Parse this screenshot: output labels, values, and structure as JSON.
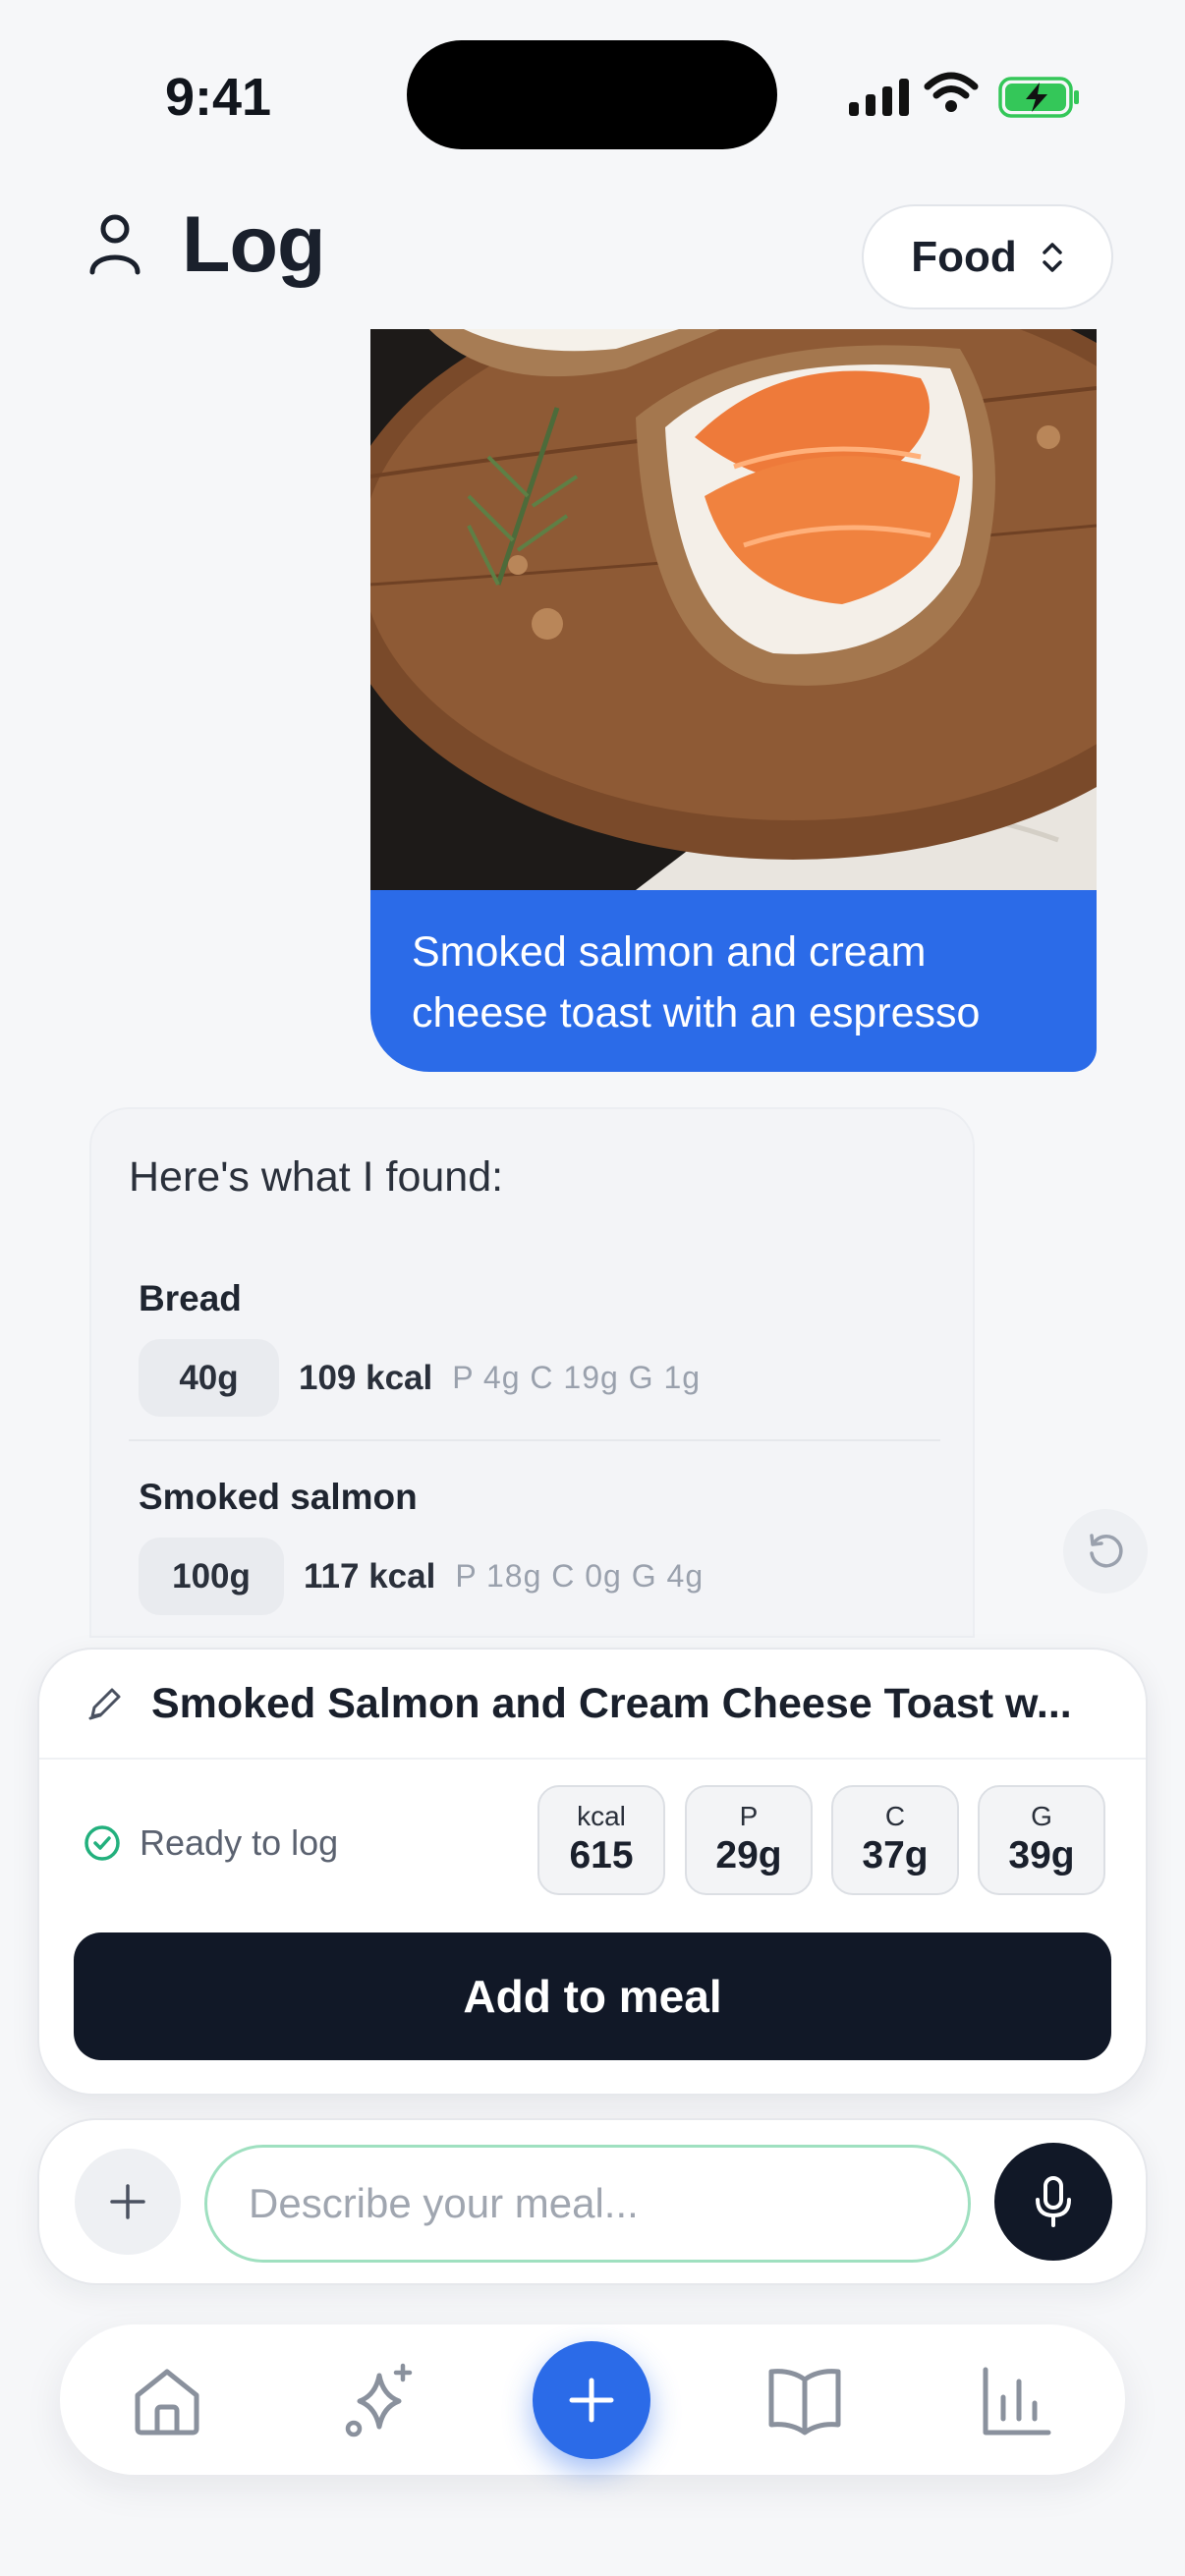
{
  "status_bar": {
    "time": "9:41"
  },
  "header": {
    "title": "Log",
    "selector_label": "Food"
  },
  "user_message": {
    "text": "Smoked salmon and cream cheese toast with an espresso"
  },
  "assistant": {
    "intro": "Here's what I found:",
    "items": [
      {
        "name": "Bread",
        "amount": "40g",
        "kcal": "109 kcal",
        "macros": "P 4g  C 19g  G 1g"
      },
      {
        "name": "Smoked salmon",
        "amount": "100g",
        "kcal": "117 kcal",
        "macros": "P 18g  C 0g  G 4g"
      }
    ]
  },
  "summary": {
    "meal_title": "Smoked Salmon and Cream Cheese Toast w...",
    "status": "Ready to log",
    "stats": [
      {
        "label": "kcal",
        "value": "615"
      },
      {
        "label": "P",
        "value": "29g"
      },
      {
        "label": "C",
        "value": "37g"
      },
      {
        "label": "G",
        "value": "39g"
      }
    ],
    "button_label": "Add to meal"
  },
  "input": {
    "placeholder": "Describe your meal..."
  },
  "tabbar": {
    "items": [
      {
        "icon": "home-icon"
      },
      {
        "icon": "sparkle-icon"
      },
      {
        "icon": "plus-icon"
      },
      {
        "icon": "book-icon"
      },
      {
        "icon": "chart-icon"
      }
    ]
  },
  "colors": {
    "accent": "#2b6be8",
    "dark": "#111827",
    "success": "#22b07d"
  }
}
